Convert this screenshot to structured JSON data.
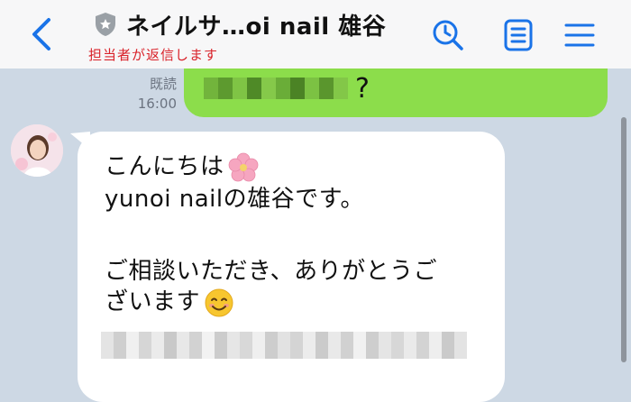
{
  "header": {
    "title": "ネイルサ…oi nail 雄谷",
    "subtitle": "担当者が返信します"
  },
  "previous_message": {
    "status": "既読",
    "time": "16:00",
    "visible_char": "?"
  },
  "message": {
    "lines": [
      "こんにちは",
      "yunoi nailの雄谷です。",
      "ご相談いただき、ありがとうご",
      "ざいます"
    ]
  },
  "colors": {
    "accent_blue": "#1a73e8",
    "outgoing_bubble": "#8cdd4b",
    "chat_background": "#cdd8e4",
    "subtitle_red": "#d9222a"
  },
  "icons": [
    "back-icon",
    "shield-icon",
    "search-icon",
    "notes-icon",
    "menu-icon",
    "cherry-blossom-emoji",
    "smiling-face-emoji"
  ]
}
